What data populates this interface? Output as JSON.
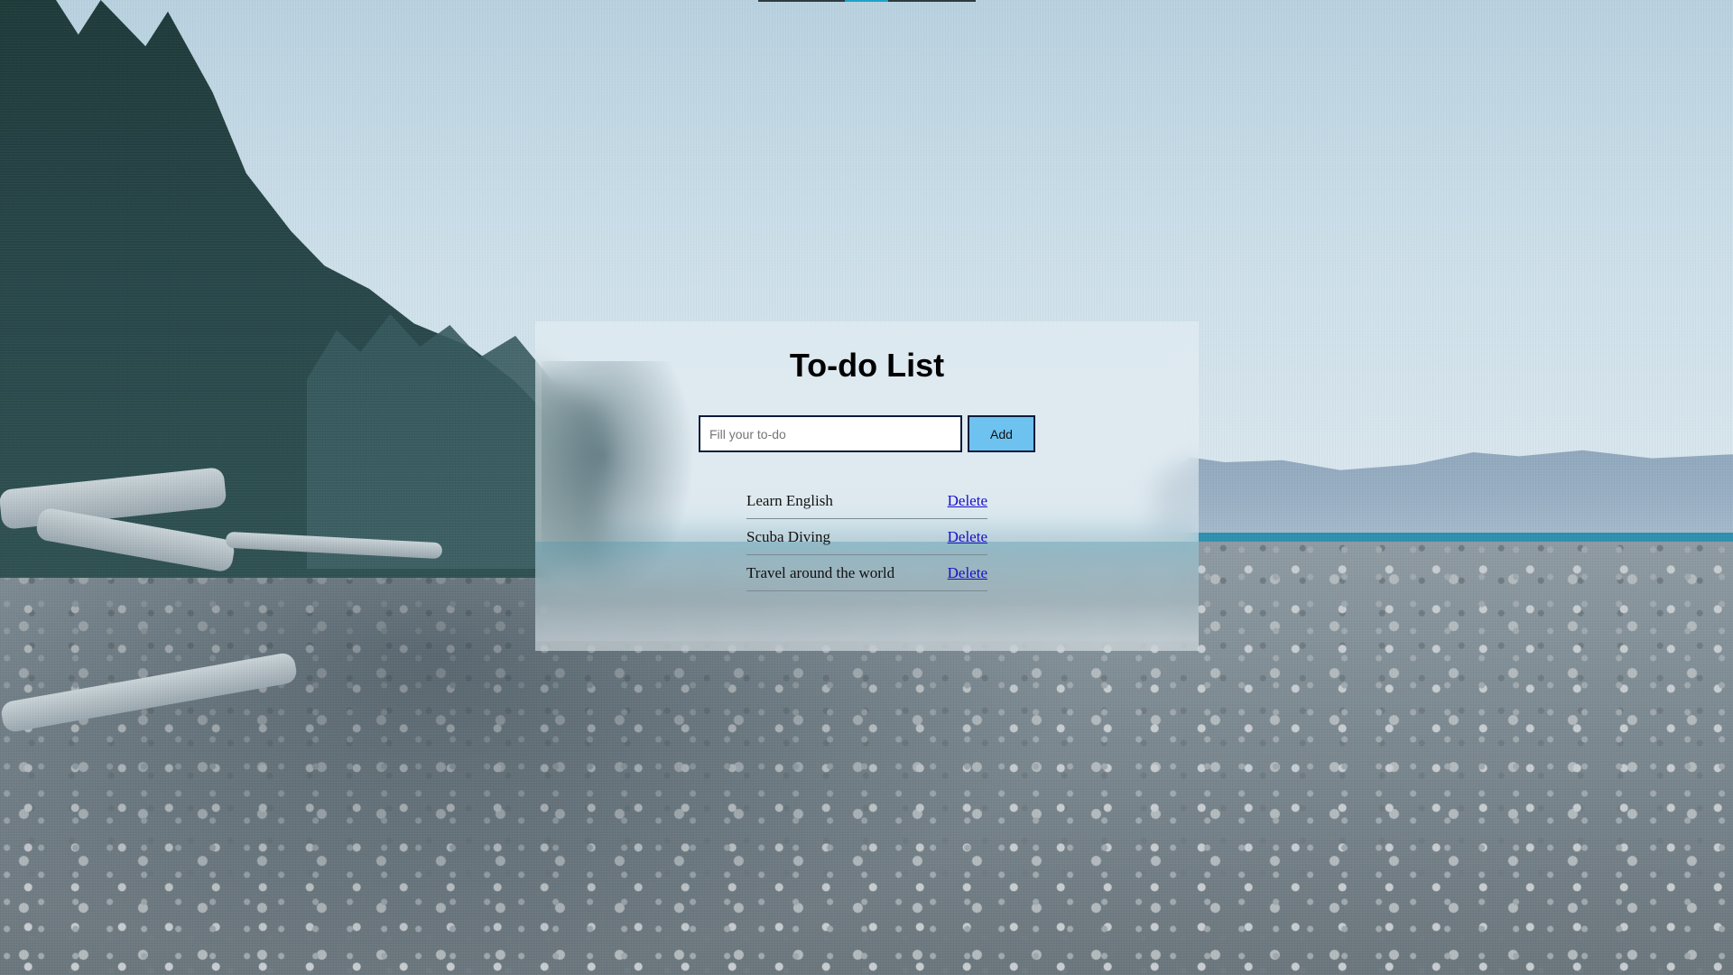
{
  "app": {
    "title": "To-do List"
  },
  "form": {
    "input_placeholder": "Fill your to-do",
    "input_value": "",
    "add_label": "Add"
  },
  "todos": [
    {
      "text": "Learn English",
      "delete_label": "Delete"
    },
    {
      "text": "Scuba Diving",
      "delete_label": "Delete"
    },
    {
      "text": "Travel around the world",
      "delete_label": "Delete"
    }
  ],
  "colors": {
    "add_button": "#6ec2f0",
    "input_border": "#0d1b3a",
    "link": "#1a0dcc"
  }
}
